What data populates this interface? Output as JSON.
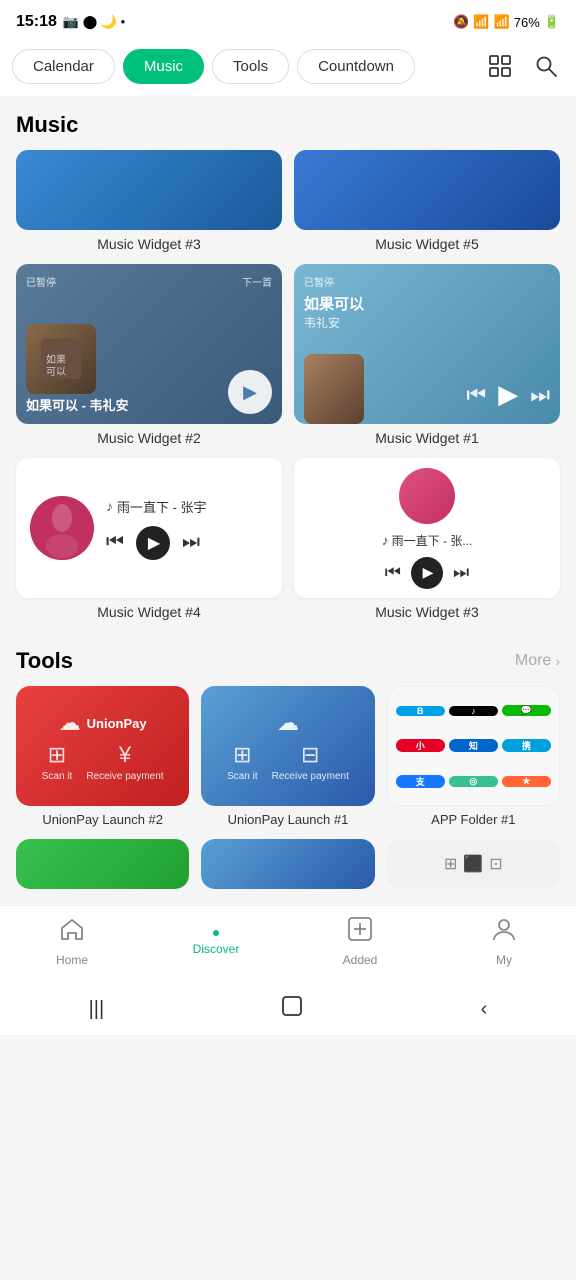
{
  "statusBar": {
    "time": "15:18",
    "batteryPercent": "76%"
  },
  "nav": {
    "pills": [
      {
        "label": "Calendar",
        "active": false
      },
      {
        "label": "Music",
        "active": true
      },
      {
        "label": "Tools",
        "active": false
      },
      {
        "label": "Countdown",
        "active": false
      }
    ]
  },
  "sections": {
    "music": {
      "title": "Music",
      "widgets": {
        "banner3": {
          "label": "Music Widget #3"
        },
        "banner5": {
          "label": "Music Widget #5"
        },
        "widget2": {
          "label": "Music Widget #2",
          "status": "已暂停",
          "next": "下一首",
          "songName": "如果可以 - 韦礼安"
        },
        "widget1": {
          "label": "Music Widget #1",
          "status": "已暂停",
          "songName": "如果可以",
          "artist": "韦礼安"
        },
        "widget4": {
          "label": "Music Widget #4",
          "song": "雨一直下 - 张宇"
        },
        "widget3small": {
          "label": "Music Widget #3",
          "song": "雨一直下 - 张..."
        }
      }
    },
    "tools": {
      "title": "Tools",
      "moreLabel": "More",
      "items": [
        {
          "label": "UnionPay Launch #2"
        },
        {
          "label": "UnionPay Launch #1"
        },
        {
          "label": "APP Folder #1"
        }
      ]
    }
  },
  "bottomNav": {
    "tabs": [
      {
        "label": "Home",
        "icon": "🏠",
        "active": false
      },
      {
        "label": "Discover",
        "icon": "●",
        "active": true
      },
      {
        "label": "Added",
        "icon": "⊞",
        "active": false
      },
      {
        "label": "My",
        "icon": "○",
        "active": false
      }
    ]
  }
}
